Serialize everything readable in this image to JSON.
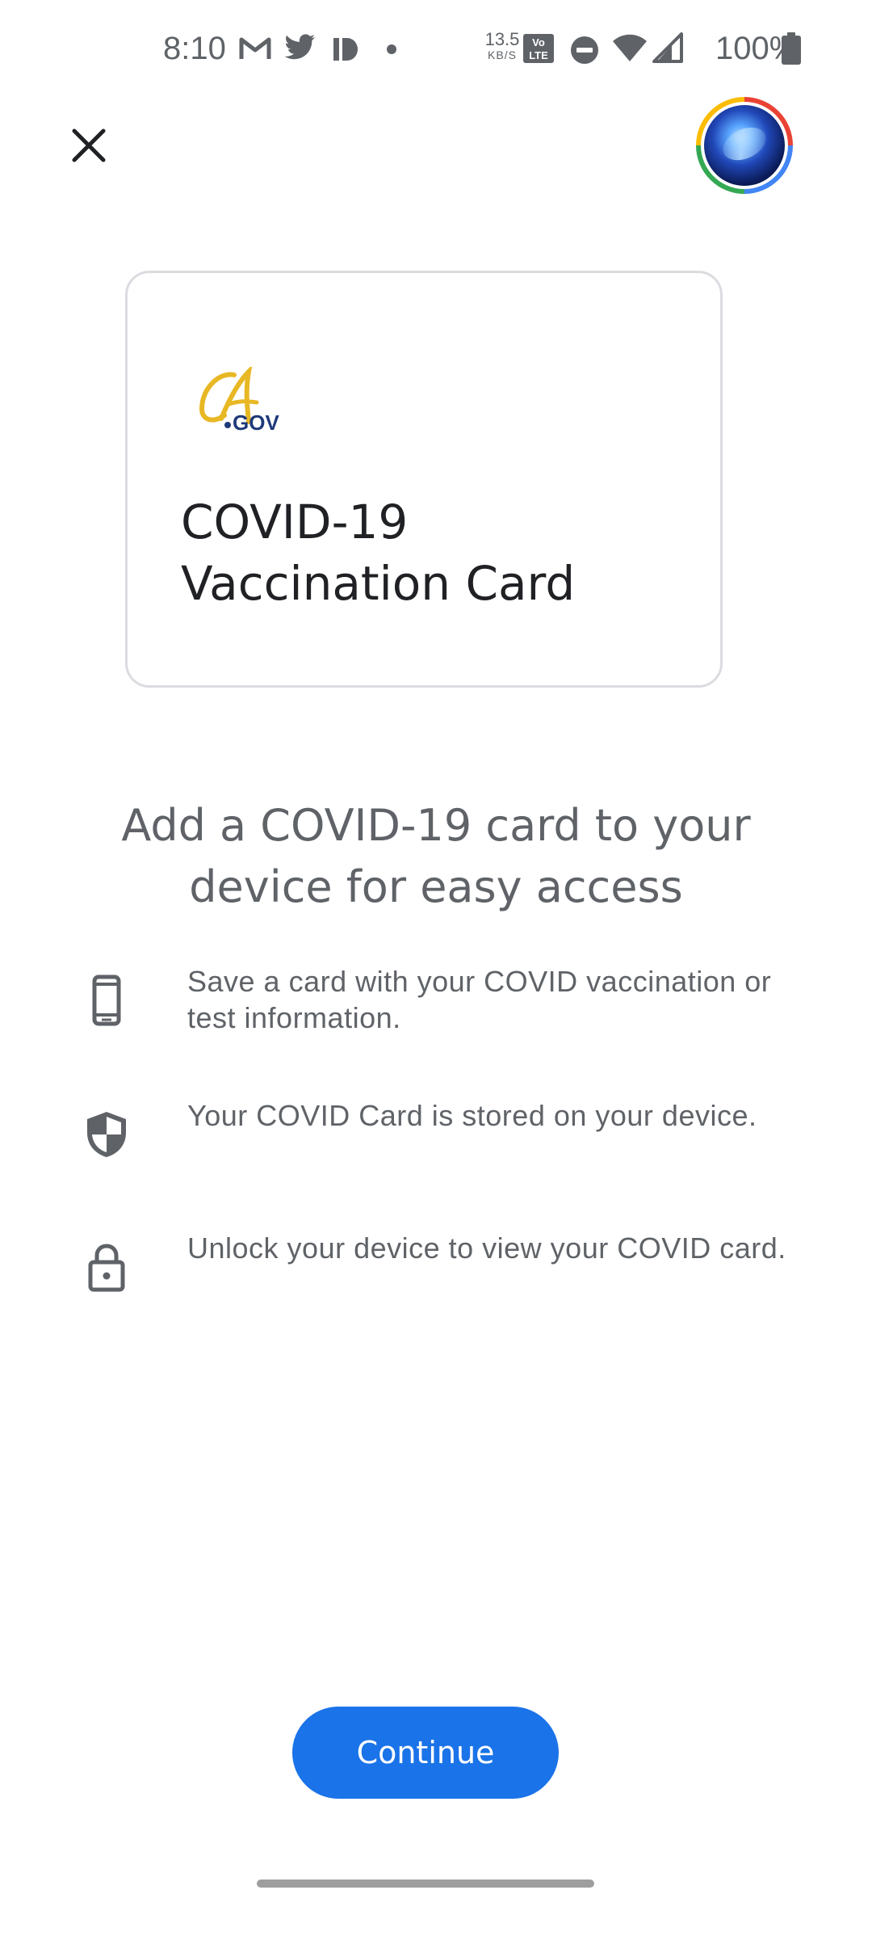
{
  "status_bar": {
    "time": "8:10",
    "notification_icons": [
      "gmail-icon",
      "twitter-icon",
      "patreon-icon",
      "more-notifications-dot-icon"
    ],
    "network_speed_value": "13.5",
    "network_speed_unit": "KB/S",
    "system_icons": [
      "volte-icon",
      "do-not-disturb-icon",
      "wifi-icon",
      "cellular-signal-icon",
      "battery-icon"
    ],
    "battery_percent": "100%"
  },
  "top_bar": {
    "close_icon": "close-icon",
    "avatar_ring_colors": [
      "#ea4335",
      "#4285f4",
      "#34a853",
      "#fbbc05"
    ]
  },
  "card_preview": {
    "issuer_logo_text": "CA.GOV",
    "title": "COVID-19 Vaccination Card"
  },
  "headline": "Add a COVID-19 card to your device for easy access",
  "features": [
    {
      "icon": "phone-icon",
      "text": "Save a card with your COVID vaccination or test information."
    },
    {
      "icon": "shield-icon",
      "text": "Your COVID Card is stored on your device."
    },
    {
      "icon": "lock-icon",
      "text": "Unlock your device to view your COVID card."
    }
  ],
  "primary_action": {
    "label": "Continue",
    "color": "#1a73e8"
  },
  "colors": {
    "accent": "#1a73e8",
    "secondary_text": "#5f6368",
    "card_border": "#dadce0"
  }
}
